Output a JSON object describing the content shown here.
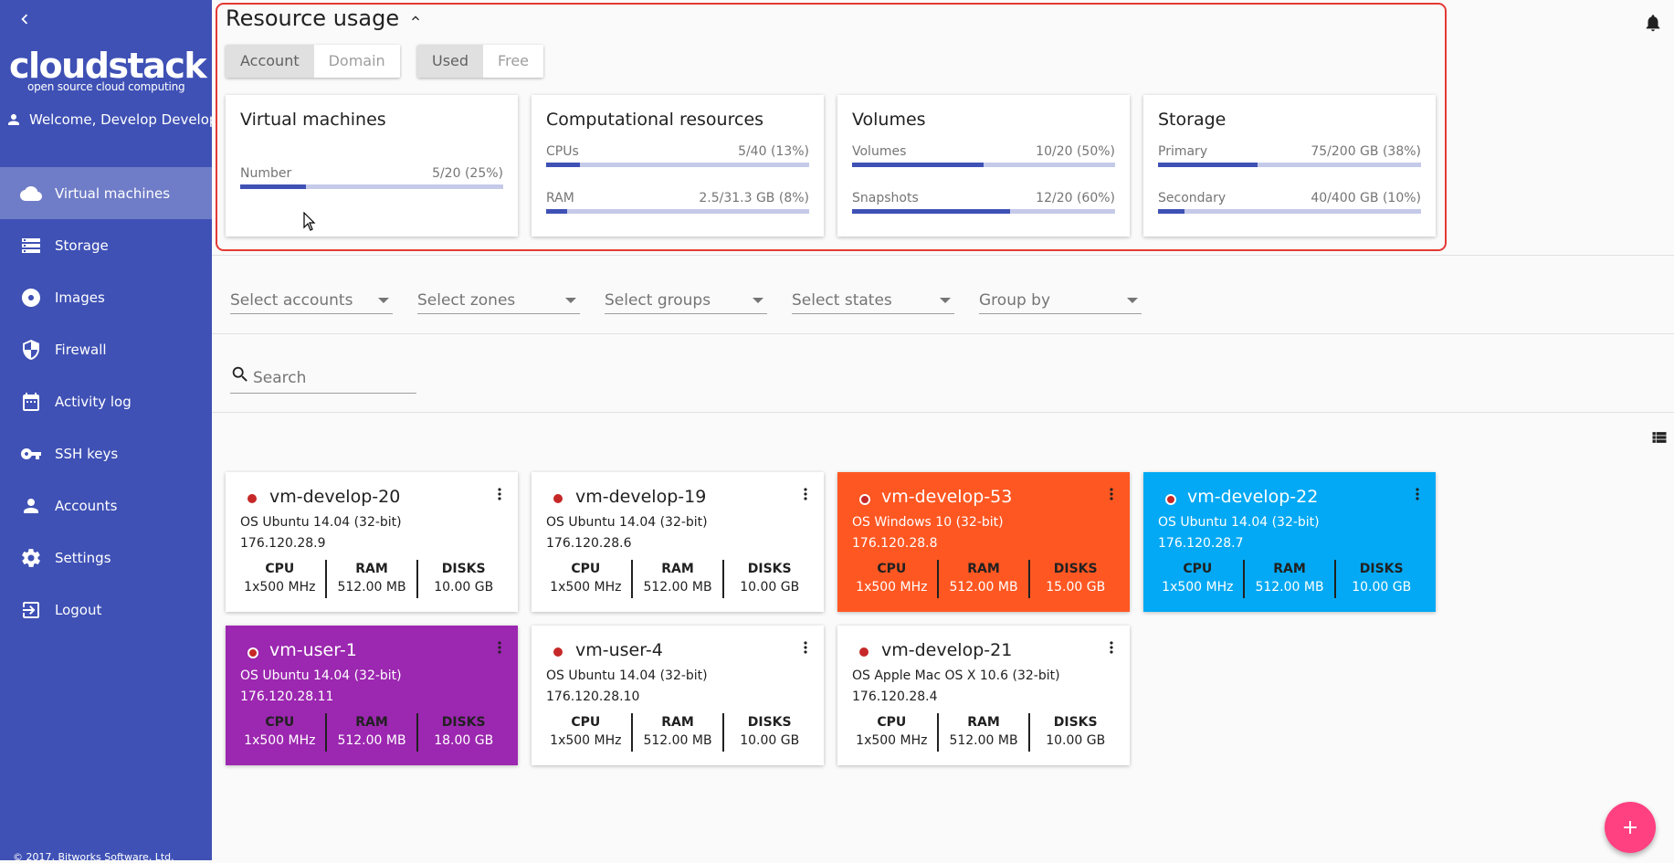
{
  "app": {
    "logo_main": "cloudstack",
    "logo_sub": "open source cloud computing",
    "welcome": "Welcome, Develop Develop",
    "footer": "© 2017, Bitworks Software, Ltd."
  },
  "sidebar": {
    "items": [
      {
        "label": "Virtual machines",
        "icon": "cloud-icon",
        "active": true
      },
      {
        "label": "Storage",
        "icon": "storage-icon"
      },
      {
        "label": "Images",
        "icon": "disc-icon"
      },
      {
        "label": "Firewall",
        "icon": "shield-icon"
      },
      {
        "label": "Activity log",
        "icon": "calendar-icon"
      },
      {
        "label": "SSH keys",
        "icon": "key-icon"
      },
      {
        "label": "Accounts",
        "icon": "person-icon"
      },
      {
        "label": "Settings",
        "icon": "gear-icon"
      },
      {
        "label": "Logout",
        "icon": "logout-icon"
      }
    ]
  },
  "usage": {
    "title": "Resource usage",
    "scope_toggle": [
      {
        "label": "Account",
        "selected": true
      },
      {
        "label": "Domain",
        "selected": false
      }
    ],
    "mode_toggle": [
      {
        "label": "Used",
        "selected": true
      },
      {
        "label": "Free",
        "selected": false
      }
    ],
    "cards": [
      {
        "title": "Virtual machines",
        "meters": [
          {
            "label": "Number",
            "value": "5/20 (25%)",
            "fraction": 0.25
          }
        ]
      },
      {
        "title": "Computational resources",
        "meters": [
          {
            "label": "CPUs",
            "value": "5/40 (13%)",
            "fraction": 0.13
          },
          {
            "label": "RAM",
            "value": "2.5/31.3 GB (8%)",
            "fraction": 0.08
          }
        ]
      },
      {
        "title": "Volumes",
        "meters": [
          {
            "label": "Volumes",
            "value": "10/20 (50%)",
            "fraction": 0.5
          },
          {
            "label": "Snapshots",
            "value": "12/20 (60%)",
            "fraction": 0.6
          }
        ]
      },
      {
        "title": "Storage",
        "meters": [
          {
            "label": "Primary",
            "value": "75/200 GB (38%)",
            "fraction": 0.38
          },
          {
            "label": "Secondary",
            "value": "40/400 GB (10%)",
            "fraction": 0.1
          }
        ]
      }
    ]
  },
  "filters": {
    "accounts": "Select accounts",
    "zones": "Select zones",
    "groups": "Select groups",
    "states": "Select states",
    "group_by": "Group by"
  },
  "search": {
    "placeholder": "Search"
  },
  "vms": [
    {
      "name": "vm-develop-20",
      "os": "OS Ubuntu 14.04 (32-bit)",
      "ip": "176.120.28.9",
      "cpu": "1x500 MHz",
      "ram": "512.00 MB",
      "disks": "10.00 GB",
      "color": "#ffffff"
    },
    {
      "name": "vm-develop-19",
      "os": "OS Ubuntu 14.04 (32-bit)",
      "ip": "176.120.28.6",
      "cpu": "1x500 MHz",
      "ram": "512.00 MB",
      "disks": "10.00 GB",
      "color": "#ffffff"
    },
    {
      "name": "vm-develop-53",
      "os": "OS Windows 10 (32-bit)",
      "ip": "176.120.28.8",
      "cpu": "1x500 MHz",
      "ram": "512.00 MB",
      "disks": "15.00 GB",
      "color": "#ff5722"
    },
    {
      "name": "vm-develop-22",
      "os": "OS Ubuntu 14.04 (32-bit)",
      "ip": "176.120.28.7",
      "cpu": "1x500 MHz",
      "ram": "512.00 MB",
      "disks": "10.00 GB",
      "color": "#03a9f4"
    },
    {
      "name": "vm-user-1",
      "os": "OS Ubuntu 14.04 (32-bit)",
      "ip": "176.120.28.11",
      "cpu": "1x500 MHz",
      "ram": "512.00 MB",
      "disks": "18.00 GB",
      "color": "#9c27b0"
    },
    {
      "name": "vm-user-4",
      "os": "OS Ubuntu 14.04 (32-bit)",
      "ip": "176.120.28.10",
      "cpu": "1x500 MHz",
      "ram": "512.00 MB",
      "disks": "10.00 GB",
      "color": "#ffffff"
    },
    {
      "name": "vm-develop-21",
      "os": "OS Apple Mac OS X 10.6 (32-bit)",
      "ip": "176.120.28.4",
      "cpu": "1x500 MHz",
      "ram": "512.00 MB",
      "disks": "10.00 GB",
      "color": "#ffffff"
    }
  ],
  "labels": {
    "cpu": "CPU",
    "ram": "RAM",
    "disks": "DISKS"
  },
  "colors": {
    "sidebar": "#3f51b5",
    "accent": "#ff4081",
    "status_dot": "#c62828",
    "highlight": "#e53935"
  }
}
